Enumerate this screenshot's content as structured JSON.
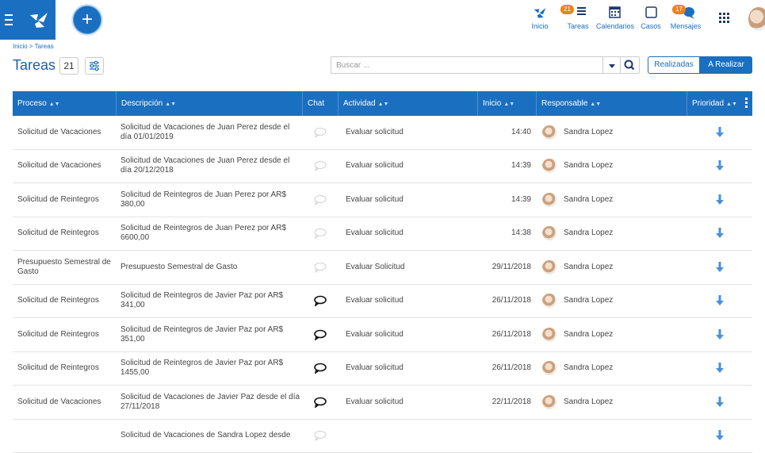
{
  "colors": {
    "primary": "#1b6fc0",
    "header_bg": "#1b6fc0",
    "badge": "#e8860f"
  },
  "topnav": {
    "items": [
      {
        "label": "Inicio",
        "icon": "home-logo-icon"
      },
      {
        "label": "Tareas",
        "icon": "tasks-icon",
        "badge": "21"
      },
      {
        "label": "Calendarios",
        "icon": "calendar-icon"
      },
      {
        "label": "Casos",
        "icon": "cases-icon"
      },
      {
        "label": "Mensajes",
        "icon": "messages-icon",
        "badge": "17"
      }
    ]
  },
  "breadcrumb": "Inicio > Tareas",
  "page": {
    "title": "Tareas",
    "count": "21"
  },
  "search": {
    "placeholder": "Buscar ..."
  },
  "toggle": {
    "left": "Realizadas",
    "right": "A Realizar",
    "active": "A Realizar"
  },
  "columns": {
    "proceso": "Proceso",
    "descripcion": "Descripción",
    "chat": "Chat",
    "actividad": "Actividad",
    "inicio": "Inicio",
    "responsable": "Responsable",
    "prioridad": "Prioridad"
  },
  "rows": [
    {
      "proceso": "Solicitud de Vacaciones",
      "descripcion": "Solicitud de Vacaciones de Juan Perez desde el día 01/01/2019",
      "chat": "empty",
      "actividad": "Evaluar solicitud",
      "inicio": "14:40",
      "responsable": "Sandra Lopez",
      "prioridad": "low"
    },
    {
      "proceso": "Solicitud de Vacaciones",
      "descripcion": "Solicitud de Vacaciones de Juan Perez desde el día 20/12/2018",
      "chat": "empty",
      "actividad": "Evaluar solicitud",
      "inicio": "14:39",
      "responsable": "Sandra Lopez",
      "prioridad": "low"
    },
    {
      "proceso": "Solicitud de Reintegros",
      "descripcion": "Solicitud de Reintegros de Juan Perez por AR$ 380,00",
      "chat": "empty",
      "actividad": "Evaluar solicitud",
      "inicio": "14:39",
      "responsable": "Sandra Lopez",
      "prioridad": "low"
    },
    {
      "proceso": "Solicitud de Reintegros",
      "descripcion": "Solicitud de Reintegros de Juan Perez por AR$ 6600,00",
      "chat": "empty",
      "actividad": "Evaluar solicitud",
      "inicio": "14:38",
      "responsable": "Sandra Lopez",
      "prioridad": "low"
    },
    {
      "proceso": "Presupuesto Semestral de Gasto",
      "descripcion": "Presupuesto Semestral de Gasto",
      "chat": "empty",
      "actividad": "Evaluar Solicitud",
      "inicio": "29/11/2018",
      "responsable": "Sandra Lopez",
      "prioridad": "low"
    },
    {
      "proceso": "Solicitud de Reintegros",
      "descripcion": "Solicitud de Reintegros de Javier Paz por AR$ 341,00",
      "chat": "active",
      "actividad": "Evaluar solicitud",
      "inicio": "26/11/2018",
      "responsable": "Sandra Lopez",
      "prioridad": "low"
    },
    {
      "proceso": "Solicitud de Reintegros",
      "descripcion": "Solicitud de Reintegros de Javier Paz por AR$ 351,00",
      "chat": "active",
      "actividad": "Evaluar solicitud",
      "inicio": "26/11/2018",
      "responsable": "Sandra Lopez",
      "prioridad": "low"
    },
    {
      "proceso": "Solicitud de Reintegros",
      "descripcion": "Solicitud de Reintegros de Javier Paz por AR$ 1455,00",
      "chat": "active",
      "actividad": "Evaluar solicitud",
      "inicio": "26/11/2018",
      "responsable": "Sandra Lopez",
      "prioridad": "low"
    },
    {
      "proceso": "Solicitud de Vacaciones",
      "descripcion": "Solicitud de Vacaciones de Javier Paz desde el día 27/11/2018",
      "chat": "active",
      "actividad": "Evaluar solicitud",
      "inicio": "22/11/2018",
      "responsable": "Sandra Lopez",
      "prioridad": "low"
    },
    {
      "proceso": "",
      "descripcion": "Solicitud de Vacaciones de Sandra Lopez desde",
      "chat": "empty",
      "actividad": "",
      "inicio": "",
      "responsable": "",
      "prioridad": "low"
    }
  ]
}
